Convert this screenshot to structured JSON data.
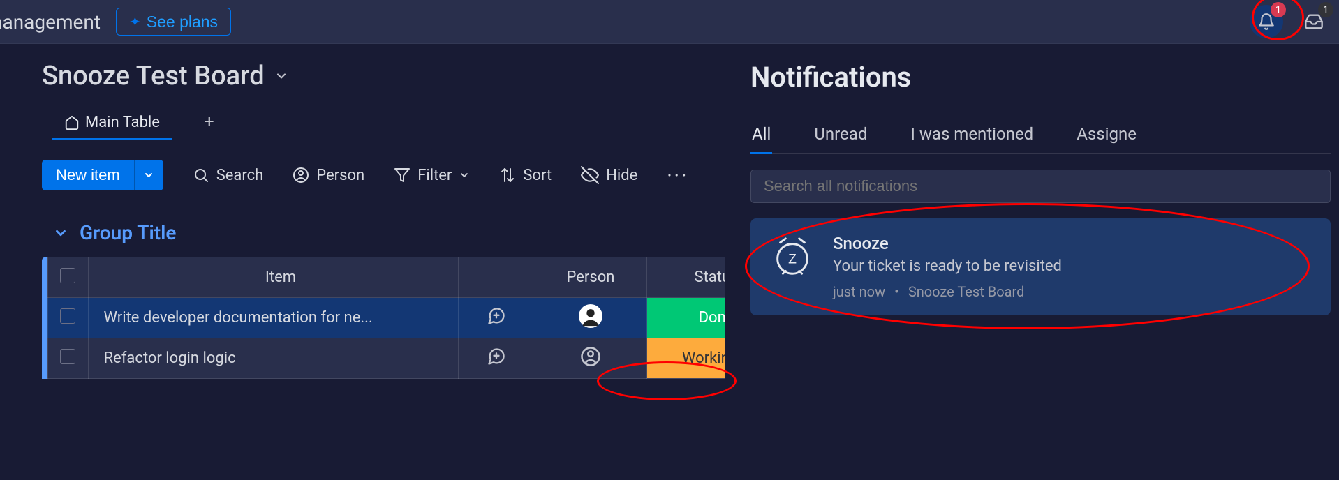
{
  "header": {
    "brand_tail": "nanagement",
    "see_plans": "See plans"
  },
  "top_right": {
    "bell_badge": "1",
    "inbox_badge": "1"
  },
  "board": {
    "title": "Snooze Test Board",
    "tabs": [
      {
        "label": "Main Table"
      }
    ],
    "toolbar": {
      "new_item": "New item",
      "search": "Search",
      "person": "Person",
      "filter": "Filter",
      "sort": "Sort",
      "hide": "Hide"
    },
    "group": {
      "title": "Group Title"
    },
    "columns": {
      "item": "Item",
      "person": "Person",
      "status": "Status"
    },
    "rows": [
      {
        "item": "Write developer documentation for ne...",
        "status": "Done",
        "status_class": "status-done",
        "selected": true
      },
      {
        "item": "Refactor login logic",
        "status": "Working o",
        "status_class": "status-working",
        "selected": false
      }
    ]
  },
  "notifications": {
    "title": "Notifications",
    "tabs": [
      {
        "label": "All",
        "active": true
      },
      {
        "label": "Unread",
        "active": false
      },
      {
        "label": "I was mentioned",
        "active": false
      },
      {
        "label": "Assigne",
        "active": false
      }
    ],
    "search_placeholder": "Search all notifications",
    "card": {
      "title": "Snooze",
      "subtitle": "Your ticket is ready to be revisited",
      "time": "just now",
      "sep": "•",
      "board": "Snooze Test Board"
    }
  }
}
